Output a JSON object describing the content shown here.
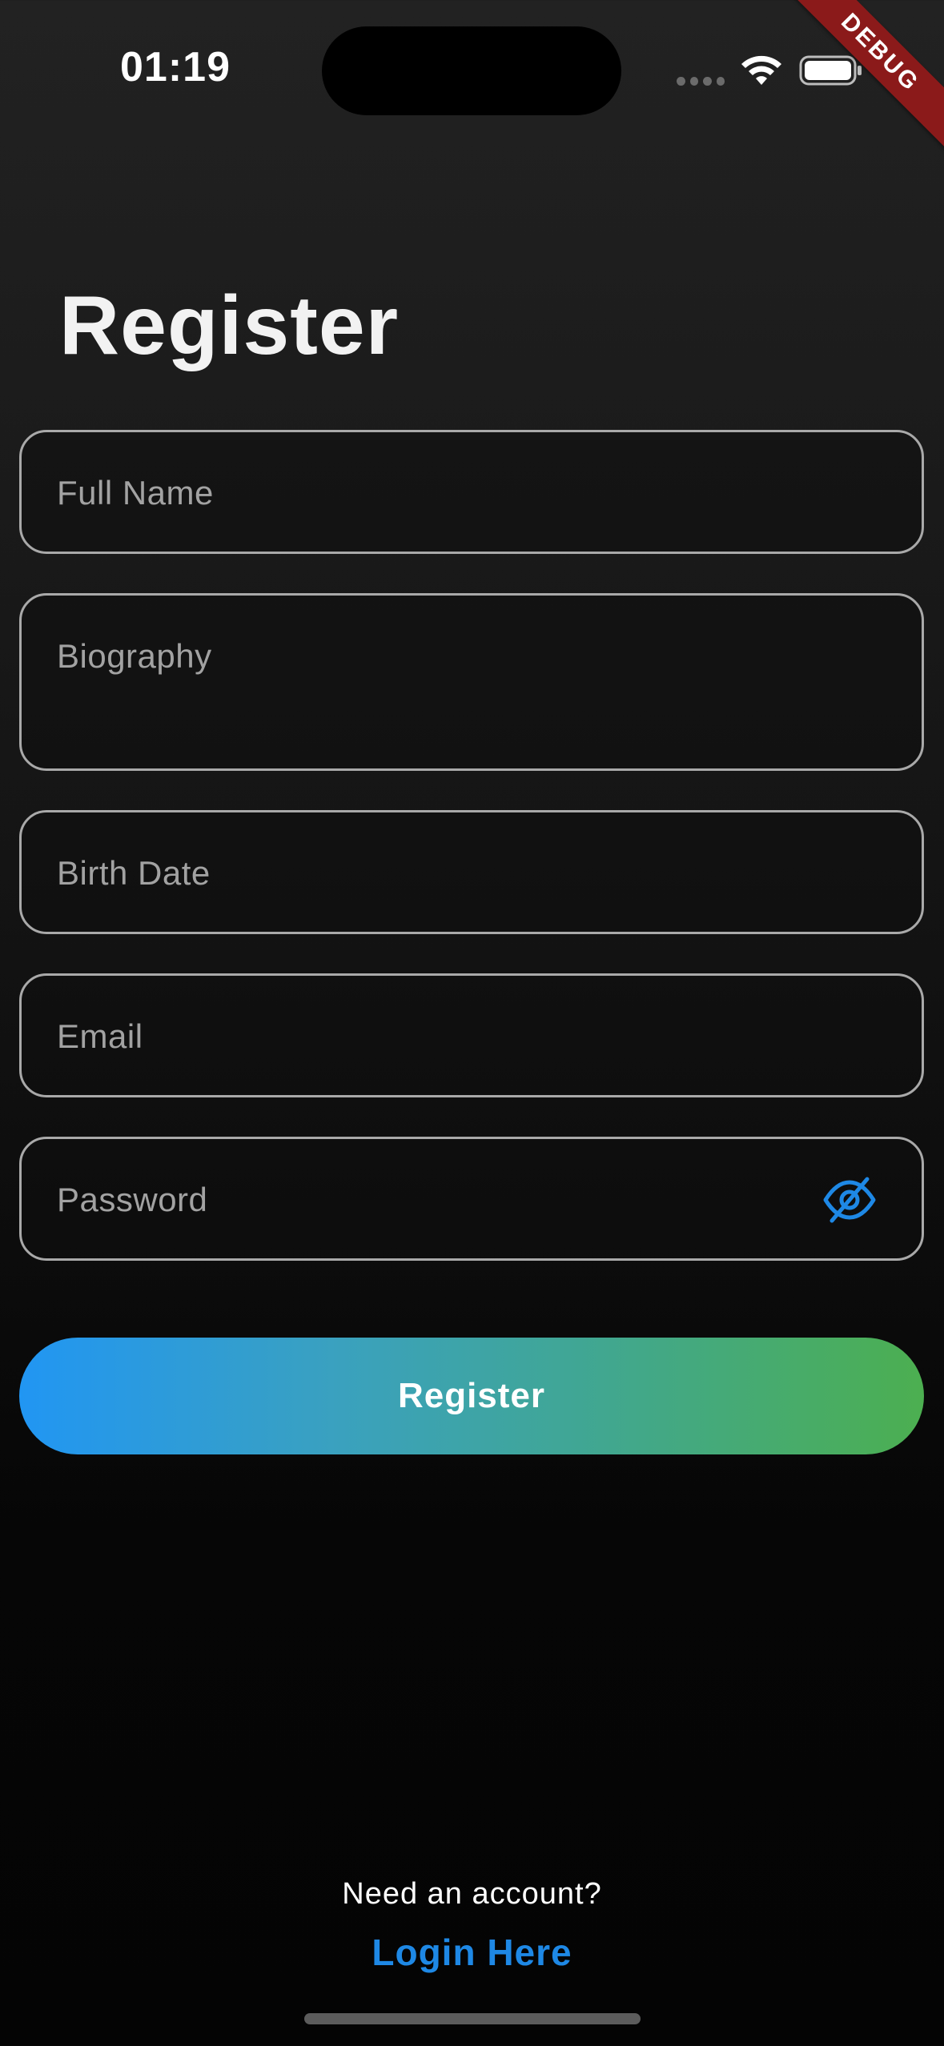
{
  "status_bar": {
    "time": "01:19"
  },
  "debug_banner": "DEBUG",
  "title": "Register",
  "fields": {
    "full_name": {
      "placeholder": "Full Name"
    },
    "biography": {
      "placeholder": "Biography"
    },
    "birth_date": {
      "placeholder": "Birth Date"
    },
    "email": {
      "placeholder": "Email"
    },
    "password": {
      "placeholder": "Password",
      "toggle_icon": "eye-slash-icon"
    }
  },
  "register_button_label": "Register",
  "footer": {
    "prompt": "Need an account?",
    "login_link": "Login Here"
  },
  "colors": {
    "accent_blue": "#2196f3",
    "accent_green": "#4caf50",
    "link_blue": "#1e88e5",
    "debug_red": "#8b1a1a"
  }
}
